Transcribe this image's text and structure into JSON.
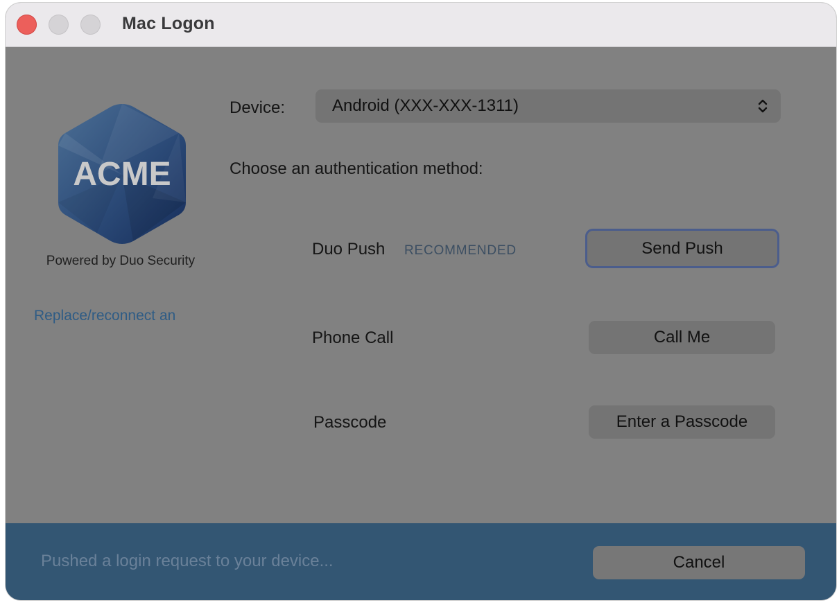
{
  "window": {
    "title": "Mac Logon"
  },
  "branding": {
    "logo_text": "ACME",
    "powered_by": "Powered by Duo Security",
    "replace_link": "Replace/reconnect an"
  },
  "device": {
    "label": "Device:",
    "selected": "Android (XXX-XXX-1311)"
  },
  "methods": {
    "heading": "Choose an authentication method:",
    "push": {
      "label": "Duo Push",
      "badge": "RECOMMENDED",
      "button": "Send Push"
    },
    "call": {
      "label": "Phone Call",
      "button": "Call Me"
    },
    "passcode": {
      "label": "Passcode",
      "button": "Enter a Passcode"
    }
  },
  "footer": {
    "status": "Pushed a login request to your device...",
    "cancel": "Cancel"
  },
  "colors": {
    "dialog_overlay": "#818181",
    "footer": "#335673",
    "close_button": "#ec5f5b",
    "focus_ring": "#4b5d8c",
    "link": "#2f5c85"
  }
}
